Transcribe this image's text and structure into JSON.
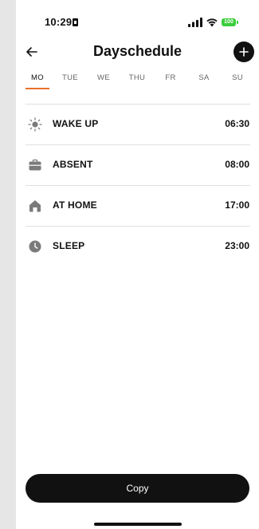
{
  "status_bar": {
    "time": "10:29",
    "battery": "100"
  },
  "header": {
    "title": "Dayschedule"
  },
  "day_tabs": [
    {
      "label": "MO",
      "active": true
    },
    {
      "label": "TUE",
      "active": false
    },
    {
      "label": "WE",
      "active": false
    },
    {
      "label": "THU",
      "active": false
    },
    {
      "label": "FR",
      "active": false
    },
    {
      "label": "SA",
      "active": false
    },
    {
      "label": "SU",
      "active": false
    }
  ],
  "schedule": [
    {
      "icon": "sun-icon",
      "label": "WAKE UP",
      "time": "06:30"
    },
    {
      "icon": "briefcase-icon",
      "label": "ABSENT",
      "time": "08:00"
    },
    {
      "icon": "home-icon",
      "label": "AT HOME",
      "time": "17:00"
    },
    {
      "icon": "clock-icon",
      "label": "SLEEP",
      "time": "23:00"
    }
  ],
  "footer": {
    "copy_label": "Copy"
  },
  "colors": {
    "accent": "#e8702a",
    "battery": "#3ccd3c",
    "primary": "#111111"
  }
}
